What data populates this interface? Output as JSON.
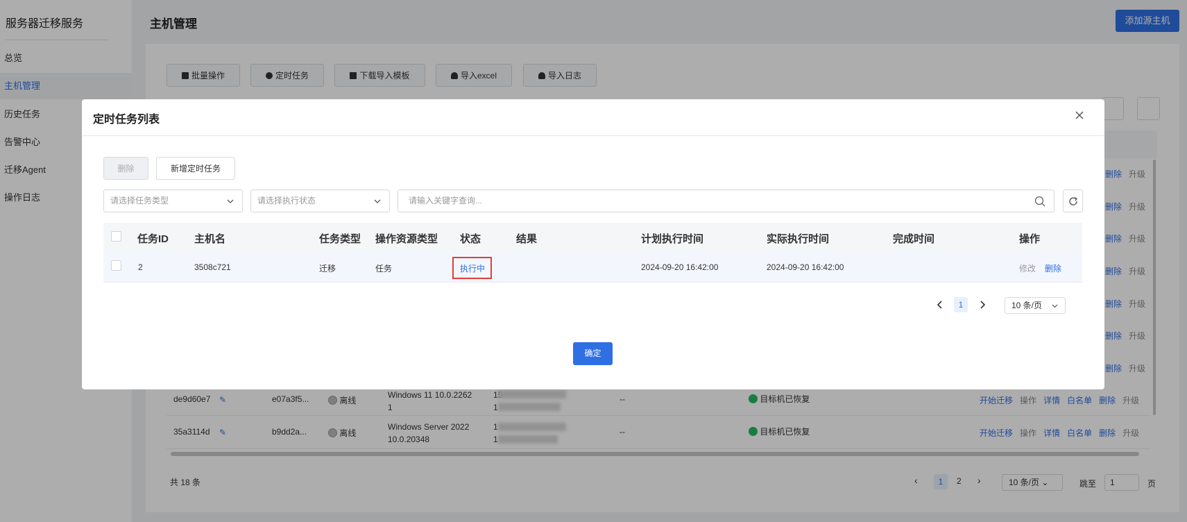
{
  "sidebar": {
    "title": "服务器迁移服务",
    "items": [
      {
        "label": "总览"
      },
      {
        "label": "主机管理"
      },
      {
        "label": "历史任务"
      },
      {
        "label": "告警中心"
      },
      {
        "label": "迁移Agent"
      },
      {
        "label": "操作日志"
      }
    ]
  },
  "header": {
    "title": "主机管理",
    "add_button": "添加源主机"
  },
  "toolbar": {
    "batch": "批量操作",
    "scheduled": "定时任务",
    "download_template": "下载导入模板",
    "import_excel": "导入excel",
    "import_log": "导入日志"
  },
  "host_table": {
    "row_actions_top": [
      "删除",
      "升级"
    ],
    "rows": [
      {
        "id": "de9d60e7",
        "name": "e07a3f5...",
        "status": "离线",
        "os_line1": "Windows 11 10.0.2262",
        "os_line2": "1",
        "ip_line1": "15",
        "ip_line2": "1",
        "dash": "--",
        "result": "目标机已恢复",
        "actions": [
          "开始迁移",
          "操作",
          "详情",
          "白名单",
          "删除",
          "升级"
        ]
      },
      {
        "id": "35a3114d",
        "name": "b9dd2a...",
        "status": "离线",
        "os_line1": "Windows Server 2022",
        "os_line2": "10.0.20348",
        "ip_line1": "1",
        "ip_line2": "1",
        "dash": "--",
        "result": "目标机已恢复",
        "actions": [
          "开始迁移",
          "操作",
          "详情",
          "白名单",
          "删除",
          "升级"
        ]
      }
    ],
    "total": "共 18 条",
    "pages": [
      "1",
      "2"
    ],
    "page_size": "10 条/页",
    "goto_label": "跳至",
    "goto_value": "1",
    "page_suffix": "页"
  },
  "modal": {
    "title": "定时任务列表",
    "delete_button": "删除",
    "add_button": "新增定时任务",
    "task_type_placeholder": "请选择任务类型",
    "exec_status_placeholder": "请选择执行状态",
    "search_placeholder": "请输入关键字查询...",
    "columns": [
      "任务ID",
      "主机名",
      "任务类型",
      "操作资源类型",
      "状态",
      "结果",
      "计划执行时间",
      "实际执行时间",
      "完成时间",
      "操作"
    ],
    "rows": [
      {
        "task_id": "2",
        "host": "3508c721",
        "task_type": "迁移",
        "resource_type": "任务",
        "status": "执行中",
        "result": "",
        "planned": "2024-09-20 16:42:00",
        "actual": "2024-09-20 16:42:00",
        "finished": "",
        "edit": "修改",
        "delete": "删除"
      }
    ],
    "page": "1",
    "page_size": "10 条/页",
    "confirm": "确定"
  },
  "colors": {
    "primary": "#2f6fe4",
    "success": "#25b864",
    "highlight": "#e53b3b"
  }
}
